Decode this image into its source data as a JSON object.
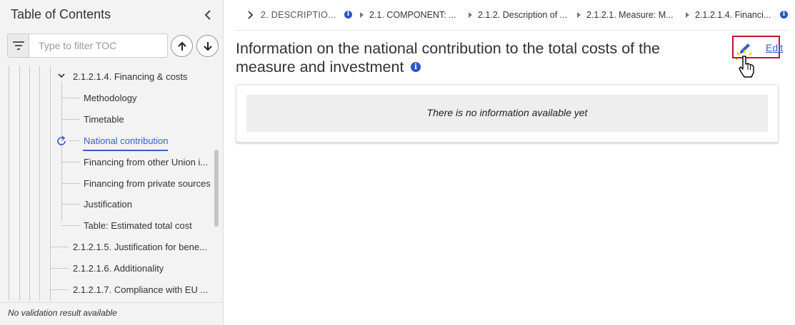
{
  "sidebar": {
    "title": "Table of Contents",
    "filter_placeholder": "Type to filter TOC",
    "items": [
      {
        "label": "2.1.2.1.4. Financing & costs"
      },
      {
        "label": "Methodology"
      },
      {
        "label": "Timetable"
      },
      {
        "label": "National contribution",
        "active": true
      },
      {
        "label": "Financing from other Union i..."
      },
      {
        "label": "Financing from private sources"
      },
      {
        "label": "Justification"
      },
      {
        "label": "Table: Estimated total cost"
      },
      {
        "label": "2.1.2.1.5. Justification for bene..."
      },
      {
        "label": "2.1.2.1.6. Additionality"
      },
      {
        "label": "2.1.2.1.7. Compliance with EU ..."
      }
    ],
    "footer": "No validation result available"
  },
  "breadcrumb": {
    "items": [
      {
        "label": "2. DESCRIPTIO..."
      },
      {
        "label": "2.1. COMPONENT: ..."
      },
      {
        "label": "2.1.2. Description of ..."
      },
      {
        "label": "2.1.2.1. Measure: M..."
      },
      {
        "label": "2.1.2.1.4. Financi..."
      }
    ],
    "info_glyph": "i"
  },
  "main": {
    "title_line1": "Information on the national contribution to the total costs of the",
    "title_line2": "measure and investment",
    "edit_label": "Edit",
    "empty_message": "There is no information available yet"
  },
  "colors": {
    "accent": "#3c5dcc",
    "info": "#2c55c8",
    "edit_highlight": "#c8102e",
    "sidebar_bg": "#f3f3f3"
  },
  "icons": [
    "chevron-left-icon",
    "filter-icon",
    "arrow-up-icon",
    "arrow-down-icon",
    "chevron-down-icon",
    "refresh-icon",
    "info-icon",
    "pencil-icon",
    "hand-cursor-icon"
  ]
}
